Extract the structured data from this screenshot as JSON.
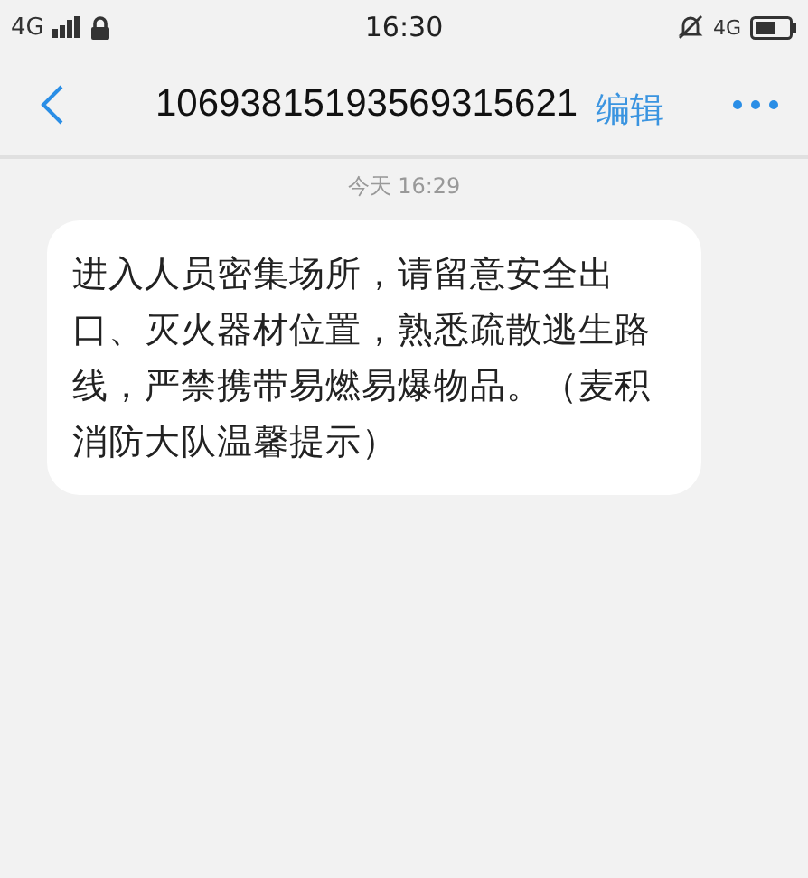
{
  "status_bar": {
    "network": "4G",
    "time": "16:30",
    "network_right": "4G"
  },
  "nav": {
    "title": "10693815193569315621",
    "edit": "编辑"
  },
  "messages": [
    {
      "timestamp": "今天 16:29",
      "text": "进入人员密集场所，请留意安全出口、灭火器材位置，熟悉疏散逃生路线，严禁携带易燃易爆物品。（麦积消防大队温馨提示）"
    }
  ]
}
